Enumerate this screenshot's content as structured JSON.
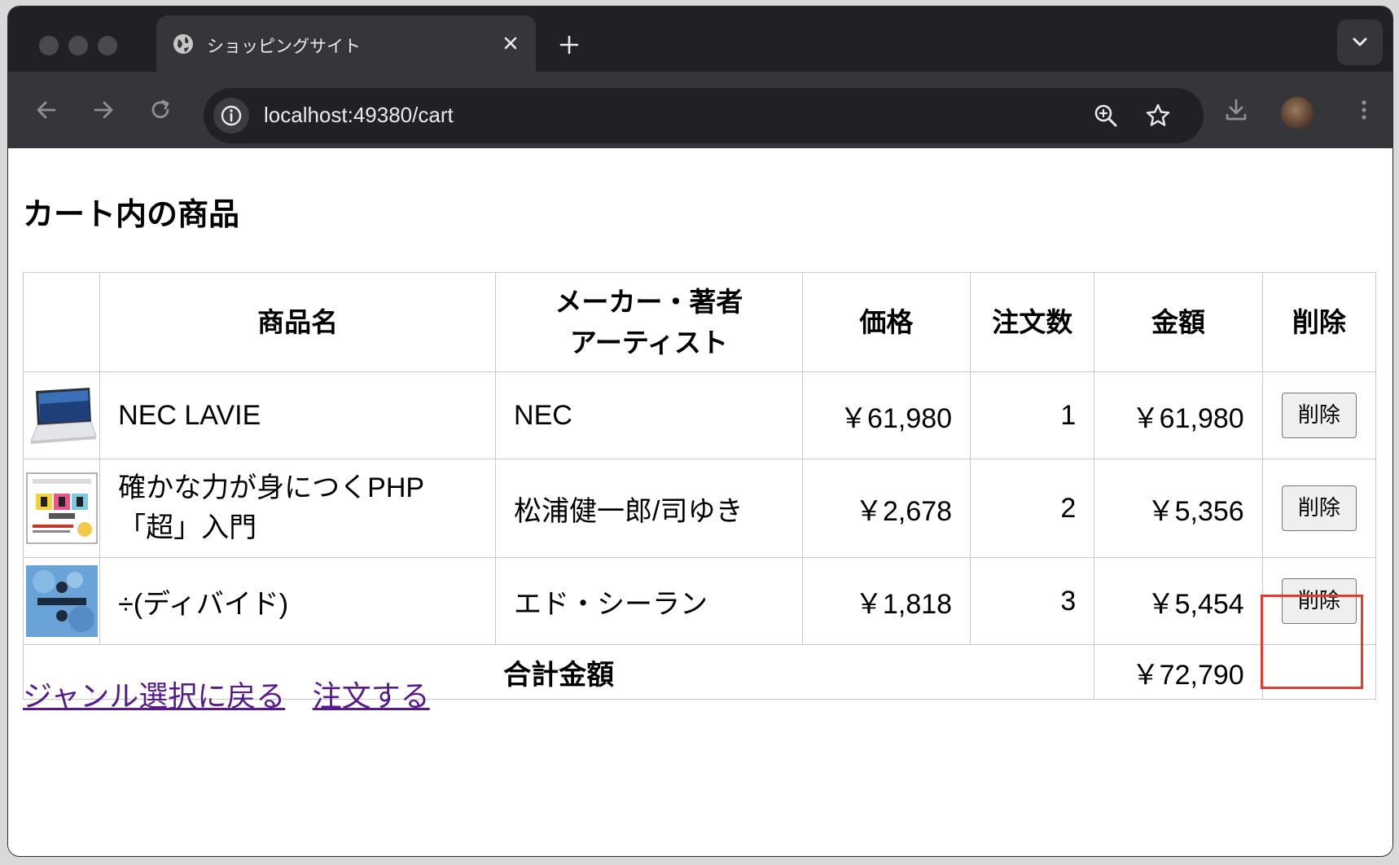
{
  "browser": {
    "tab_title": "ショッピングサイト",
    "url": "localhost:49380/cart"
  },
  "page": {
    "title": "カート内の商品",
    "table": {
      "headers": {
        "name": "商品名",
        "maker_line1": "メーカー・著者",
        "maker_line2": "アーティスト",
        "price": "価格",
        "quantity": "注文数",
        "amount": "金額",
        "delete": "削除"
      },
      "rows": [
        {
          "name": "NEC LAVIE",
          "maker": "NEC",
          "price": "￥61,980",
          "quantity": "1",
          "amount": "￥61,980",
          "delete_label": "削除",
          "thumbnail": "laptop-image"
        },
        {
          "name": "確かな力が身につくPHP「超」入門",
          "maker": "松浦健一郎/司ゆき",
          "price": "￥2,678",
          "quantity": "2",
          "amount": "￥5,356",
          "delete_label": "削除",
          "thumbnail": "php-book-cover"
        },
        {
          "name": "÷(ディバイド)",
          "maker": "エド・シーラン",
          "price": "￥1,818",
          "quantity": "3",
          "amount": "￥5,454",
          "delete_label": "削除",
          "thumbnail": "album-cover"
        }
      ],
      "total_label": "合計金額",
      "total_amount": "￥72,790"
    },
    "links": {
      "back": "ジャンル選択に戻る",
      "order": "注文する"
    }
  },
  "colors": {
    "highlight": "#e53b2c",
    "link": "#551a8b"
  }
}
